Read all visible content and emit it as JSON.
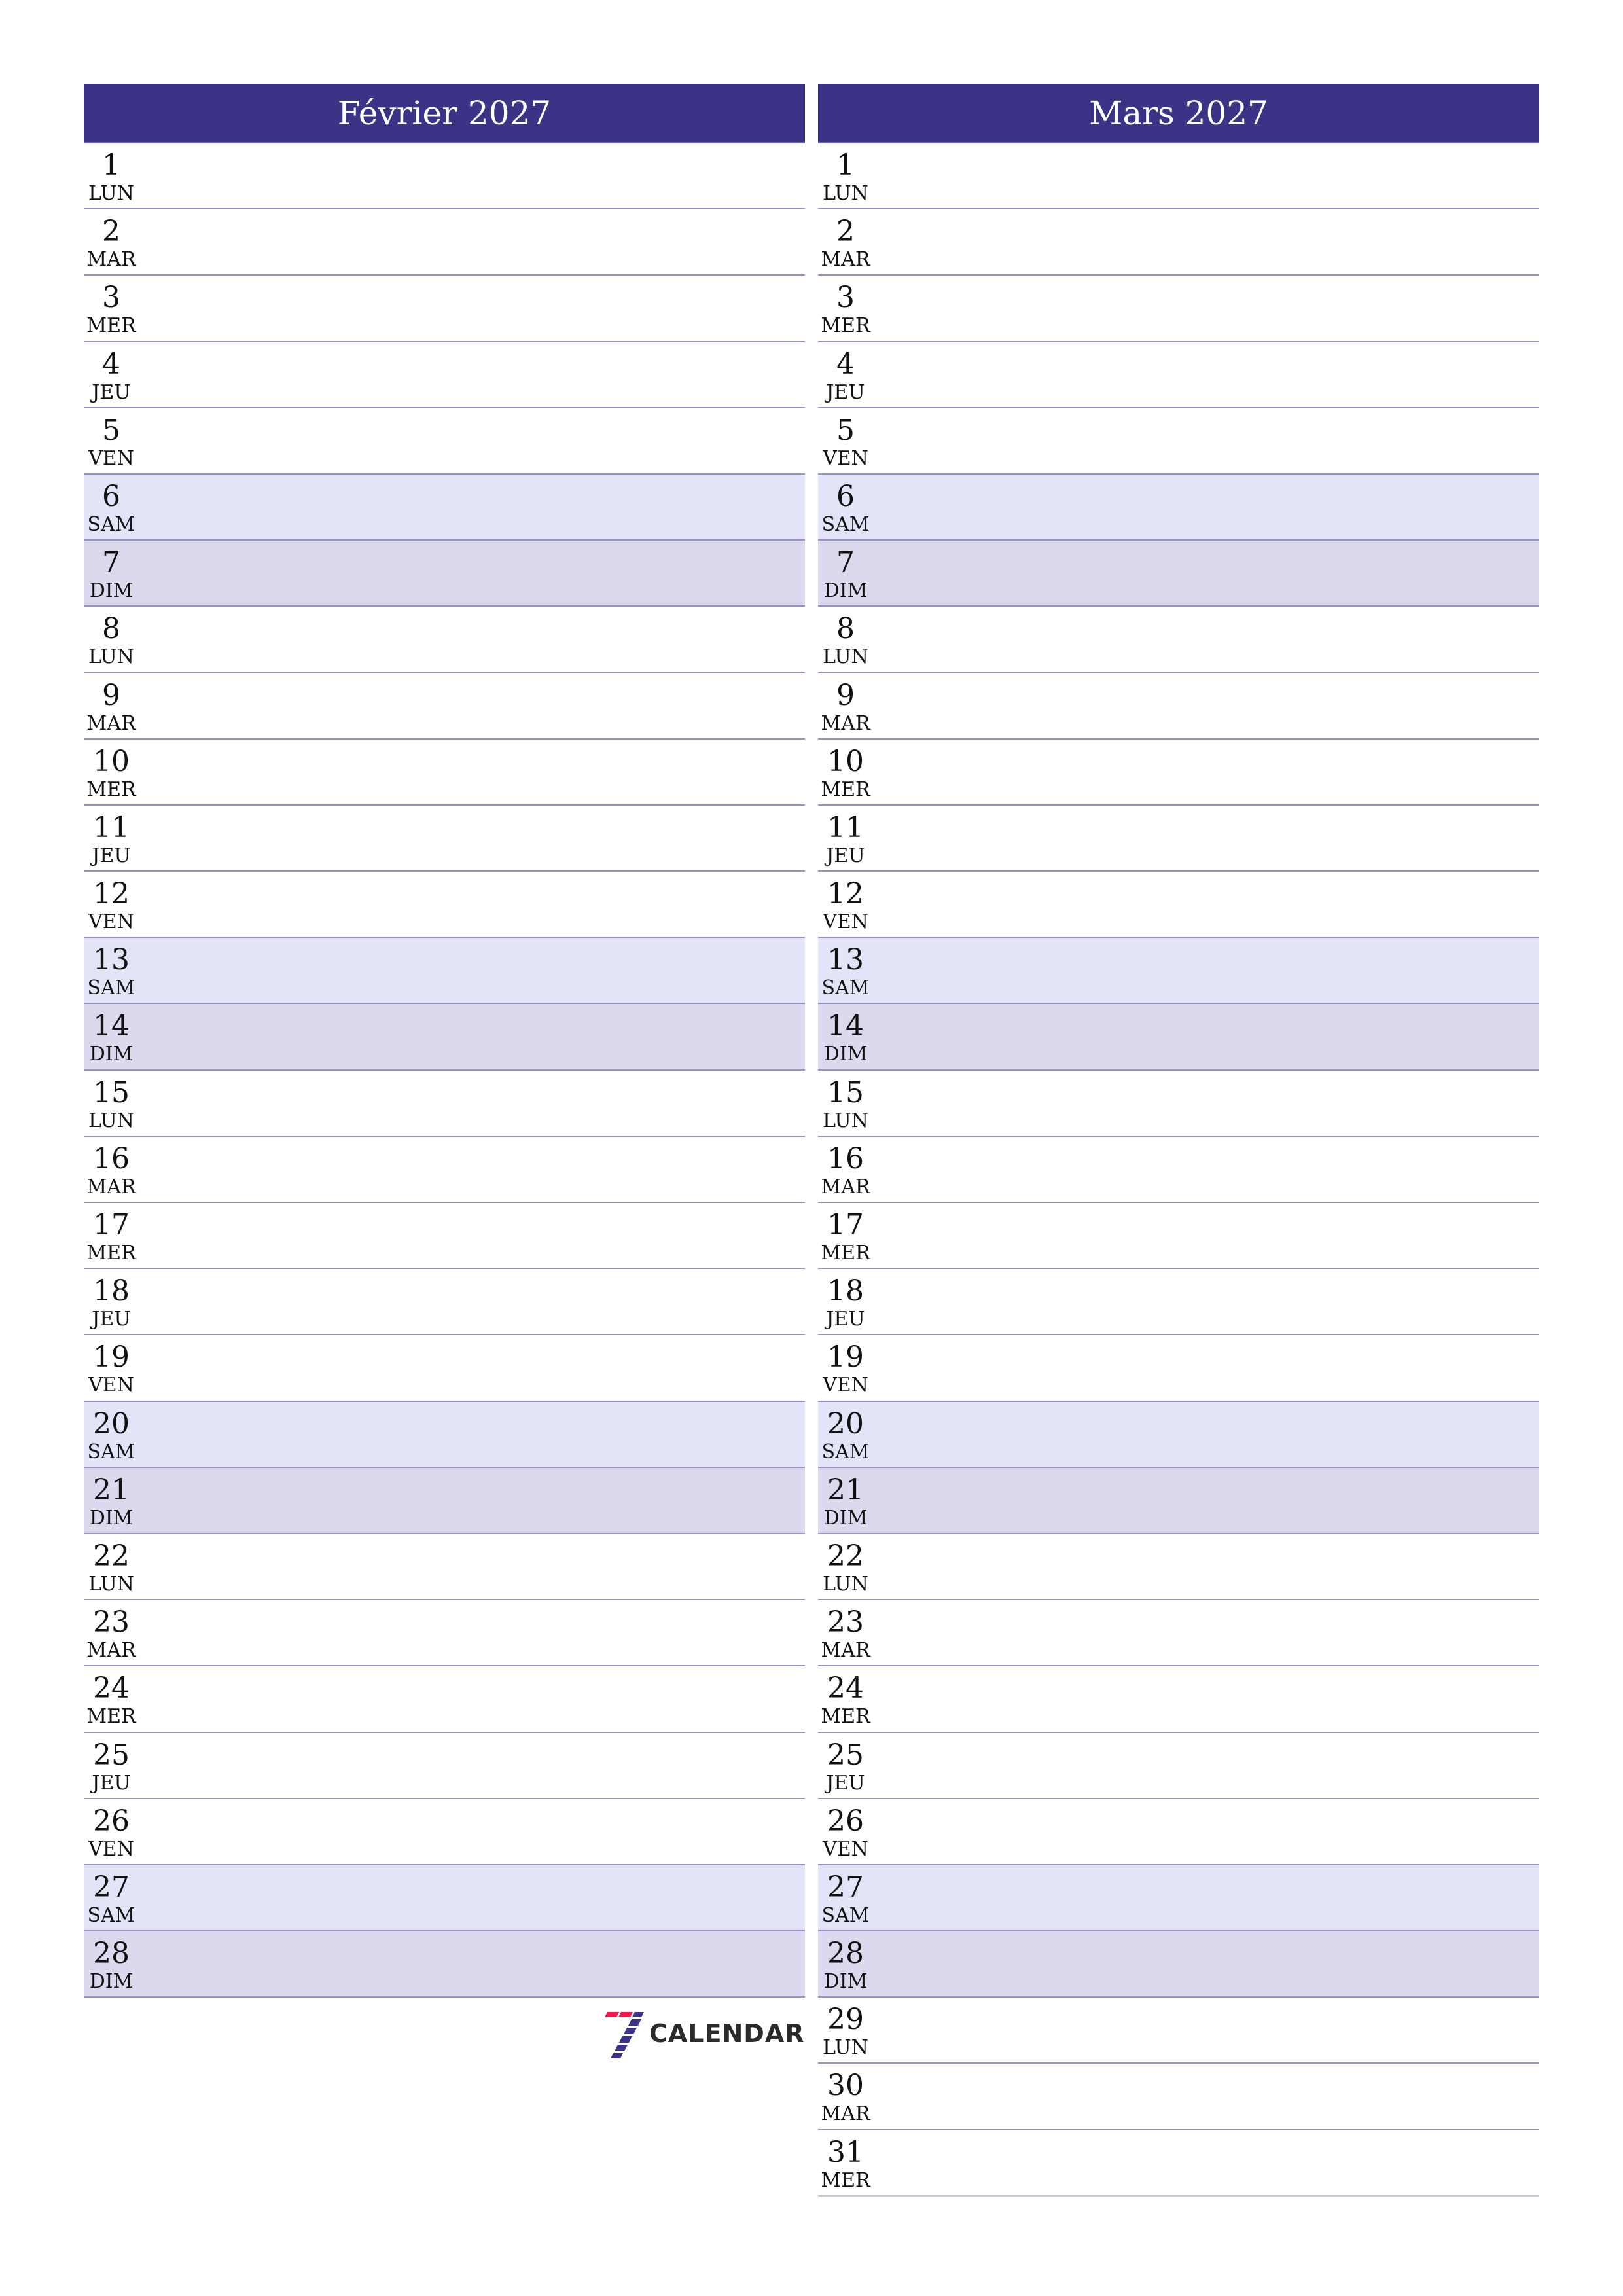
{
  "months": [
    {
      "title": "Février 2027",
      "days": [
        {
          "num": "1",
          "name": "LUN"
        },
        {
          "num": "2",
          "name": "MAR"
        },
        {
          "num": "3",
          "name": "MER"
        },
        {
          "num": "4",
          "name": "JEU"
        },
        {
          "num": "5",
          "name": "VEN"
        },
        {
          "num": "6",
          "name": "SAM"
        },
        {
          "num": "7",
          "name": "DIM"
        },
        {
          "num": "8",
          "name": "LUN"
        },
        {
          "num": "9",
          "name": "MAR"
        },
        {
          "num": "10",
          "name": "MER"
        },
        {
          "num": "11",
          "name": "JEU"
        },
        {
          "num": "12",
          "name": "VEN"
        },
        {
          "num": "13",
          "name": "SAM"
        },
        {
          "num": "14",
          "name": "DIM"
        },
        {
          "num": "15",
          "name": "LUN"
        },
        {
          "num": "16",
          "name": "MAR"
        },
        {
          "num": "17",
          "name": "MER"
        },
        {
          "num": "18",
          "name": "JEU"
        },
        {
          "num": "19",
          "name": "VEN"
        },
        {
          "num": "20",
          "name": "SAM"
        },
        {
          "num": "21",
          "name": "DIM"
        },
        {
          "num": "22",
          "name": "LUN"
        },
        {
          "num": "23",
          "name": "MAR"
        },
        {
          "num": "24",
          "name": "MER"
        },
        {
          "num": "25",
          "name": "JEU"
        },
        {
          "num": "26",
          "name": "VEN"
        },
        {
          "num": "27",
          "name": "SAM"
        },
        {
          "num": "28",
          "name": "DIM"
        }
      ]
    },
    {
      "title": "Mars 2027",
      "days": [
        {
          "num": "1",
          "name": "LUN"
        },
        {
          "num": "2",
          "name": "MAR"
        },
        {
          "num": "3",
          "name": "MER"
        },
        {
          "num": "4",
          "name": "JEU"
        },
        {
          "num": "5",
          "name": "VEN"
        },
        {
          "num": "6",
          "name": "SAM"
        },
        {
          "num": "7",
          "name": "DIM"
        },
        {
          "num": "8",
          "name": "LUN"
        },
        {
          "num": "9",
          "name": "MAR"
        },
        {
          "num": "10",
          "name": "MER"
        },
        {
          "num": "11",
          "name": "JEU"
        },
        {
          "num": "12",
          "name": "VEN"
        },
        {
          "num": "13",
          "name": "SAM"
        },
        {
          "num": "14",
          "name": "DIM"
        },
        {
          "num": "15",
          "name": "LUN"
        },
        {
          "num": "16",
          "name": "MAR"
        },
        {
          "num": "17",
          "name": "MER"
        },
        {
          "num": "18",
          "name": "JEU"
        },
        {
          "num": "19",
          "name": "VEN"
        },
        {
          "num": "20",
          "name": "SAM"
        },
        {
          "num": "21",
          "name": "DIM"
        },
        {
          "num": "22",
          "name": "LUN"
        },
        {
          "num": "23",
          "name": "MAR"
        },
        {
          "num": "24",
          "name": "MER"
        },
        {
          "num": "25",
          "name": "JEU"
        },
        {
          "num": "26",
          "name": "VEN"
        },
        {
          "num": "27",
          "name": "SAM"
        },
        {
          "num": "28",
          "name": "DIM"
        },
        {
          "num": "29",
          "name": "LUN"
        },
        {
          "num": "30",
          "name": "MAR"
        },
        {
          "num": "31",
          "name": "MER"
        }
      ]
    }
  ],
  "weekend": {
    "saturday": "SAM",
    "sunday": "DIM"
  },
  "colors": {
    "header": "#3a3386",
    "saturday_bg": "#e4e4f8",
    "sunday_bg": "#dcd8ee",
    "row_border": "#9692c4",
    "logo_red": "#f0194a",
    "logo_blue": "#3a3487"
  },
  "logo": {
    "icon": "seven-logo-icon",
    "text": "CALENDAR"
  }
}
